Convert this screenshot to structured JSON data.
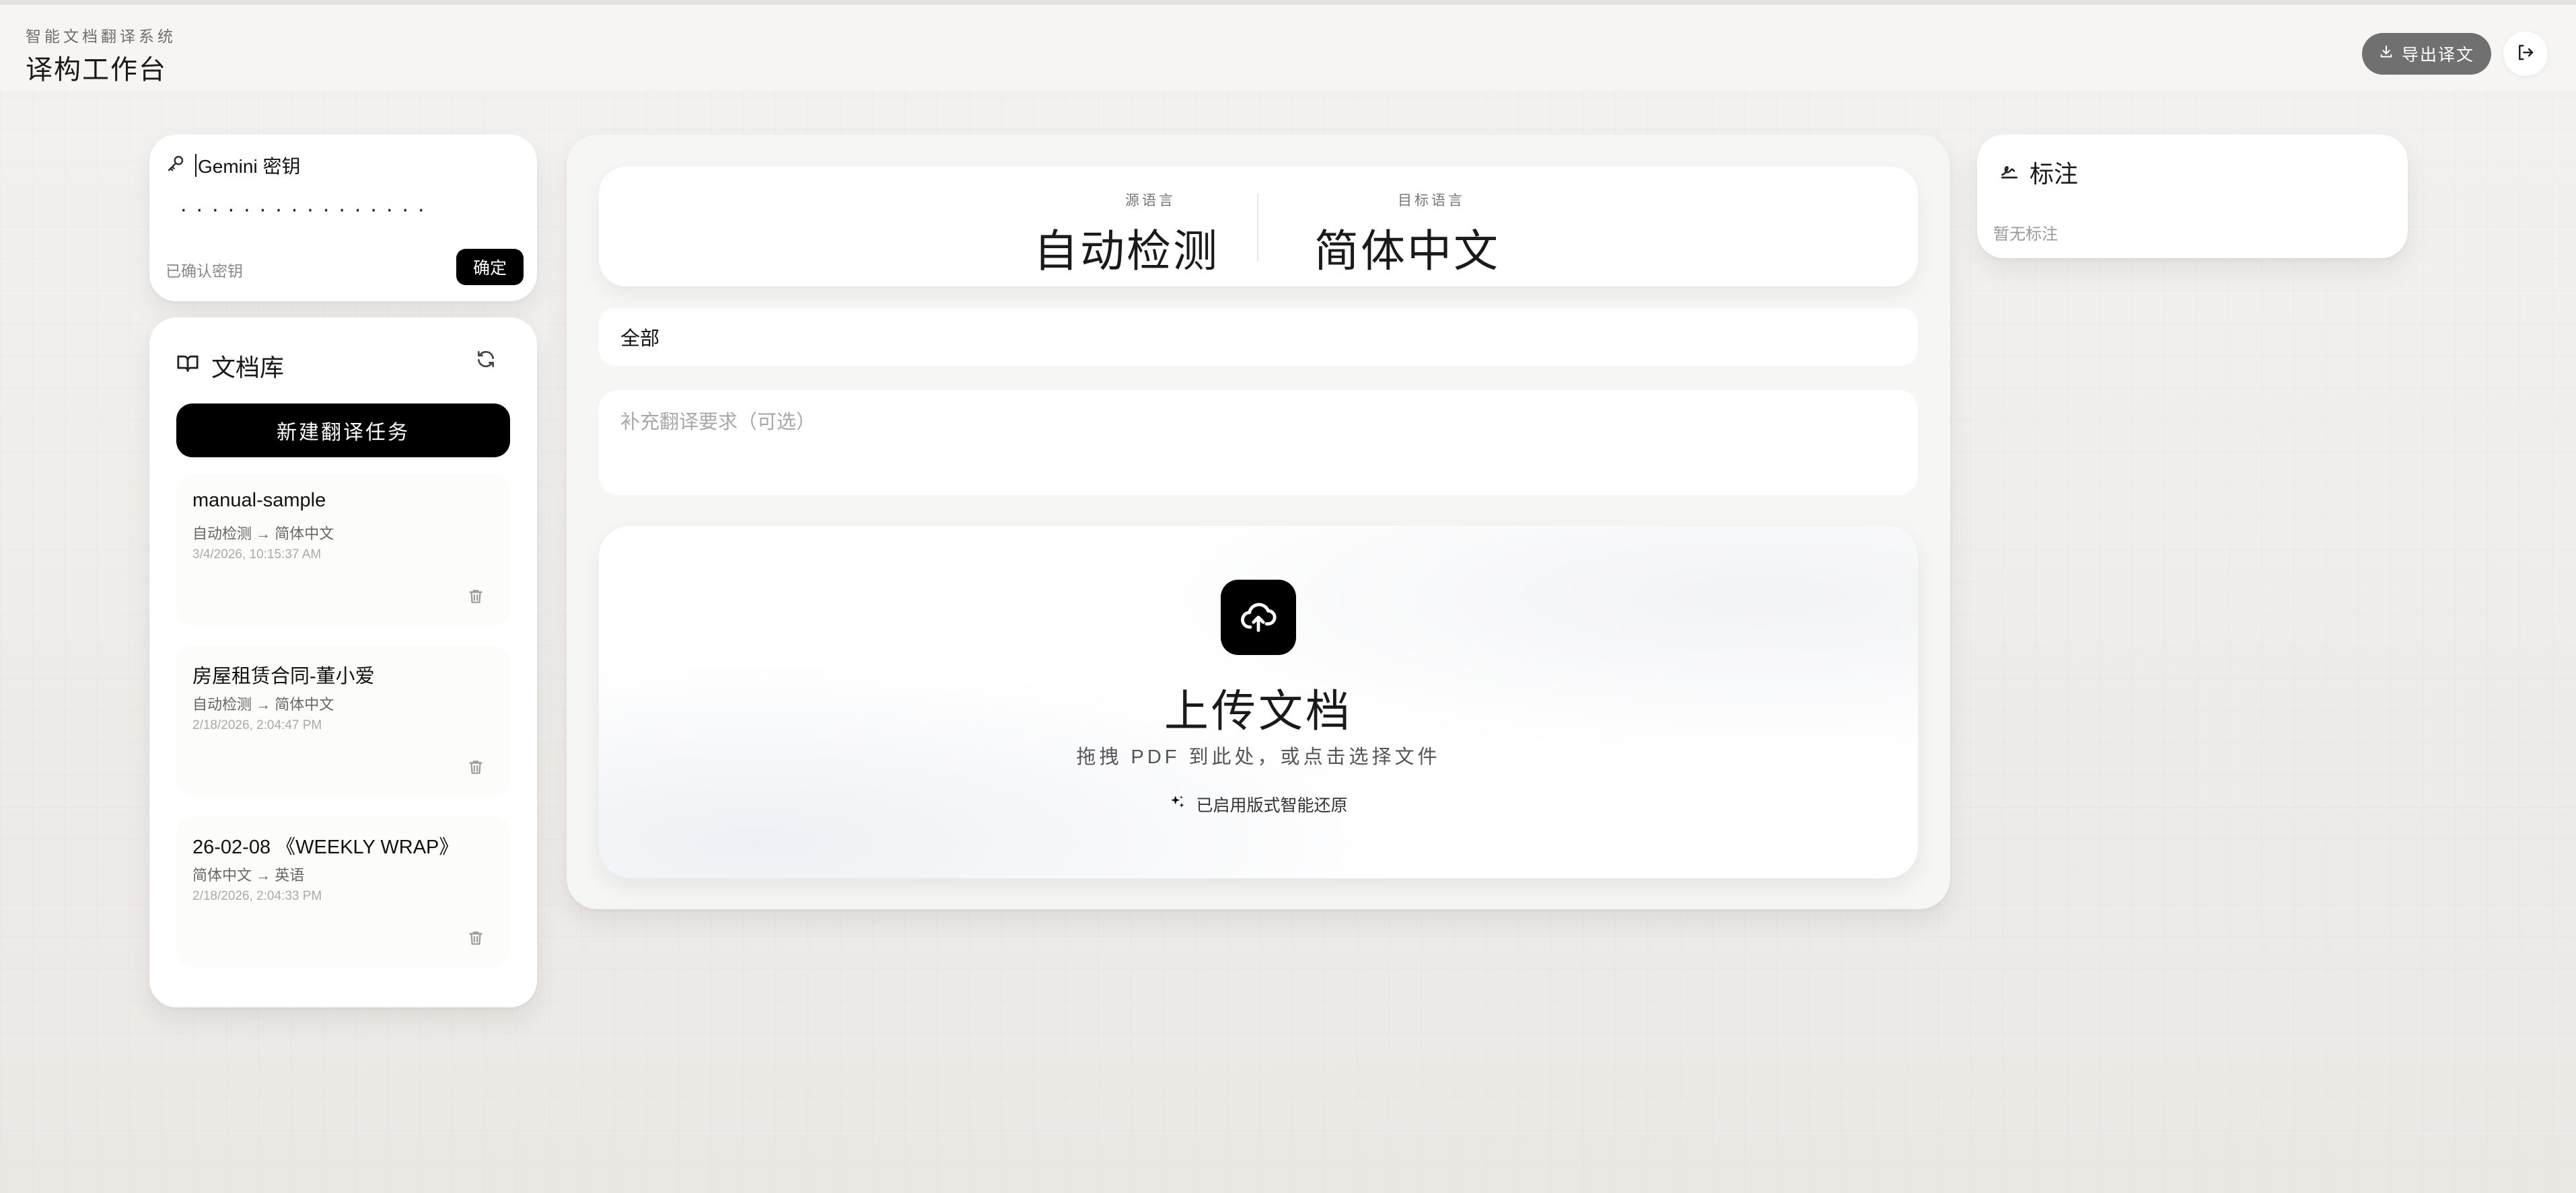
{
  "header": {
    "subtitle": "智能文档翻译系统",
    "title": "译构工作台",
    "export_label": "导出译文",
    "export_icon": "download-icon",
    "logout_icon": "logout-icon"
  },
  "api_key": {
    "label": "Gemini 密钥",
    "icon": "key-icon",
    "masked_value": "················",
    "status": "已确认密钥",
    "confirm_label": "确定"
  },
  "library": {
    "title": "文档库",
    "icon": "book-icon",
    "refresh_icon": "refresh-icon",
    "new_task_label": "新建翻译任务",
    "documents": [
      {
        "title": "manual-sample",
        "langs": "自动检测 → 简体中文",
        "time": "3/4/2026, 10:15:37 AM"
      },
      {
        "title": "房屋租赁合同-董小爱",
        "langs": "自动检测 → 简体中文",
        "time": "2/18/2026, 2:04:47 PM"
      },
      {
        "title": "26-02-08 《WEEKLY WRAP》",
        "langs": "简体中文 → 英语",
        "time": "2/18/2026, 2:04:33 PM"
      }
    ]
  },
  "translation": {
    "source_caption": "源语言",
    "source_value": "自动检测",
    "target_caption": "目标语言",
    "target_value": "简体中文",
    "scope_value": "全部",
    "requirements_placeholder": "补充翻译要求（可选）"
  },
  "upload": {
    "icon": "cloud-upload-icon",
    "title": "上传文档",
    "hint": "拖拽 PDF 到此处，或点击选择文件",
    "feature_icon": "sparkle-icon",
    "feature_text": "已启用版式智能还原"
  },
  "annotations": {
    "title": "标注",
    "icon": "signature-icon",
    "empty_text": "暂无标注"
  },
  "colors": {
    "background": "#efedea",
    "primary_button": "#000000",
    "export_button": "#707070"
  }
}
